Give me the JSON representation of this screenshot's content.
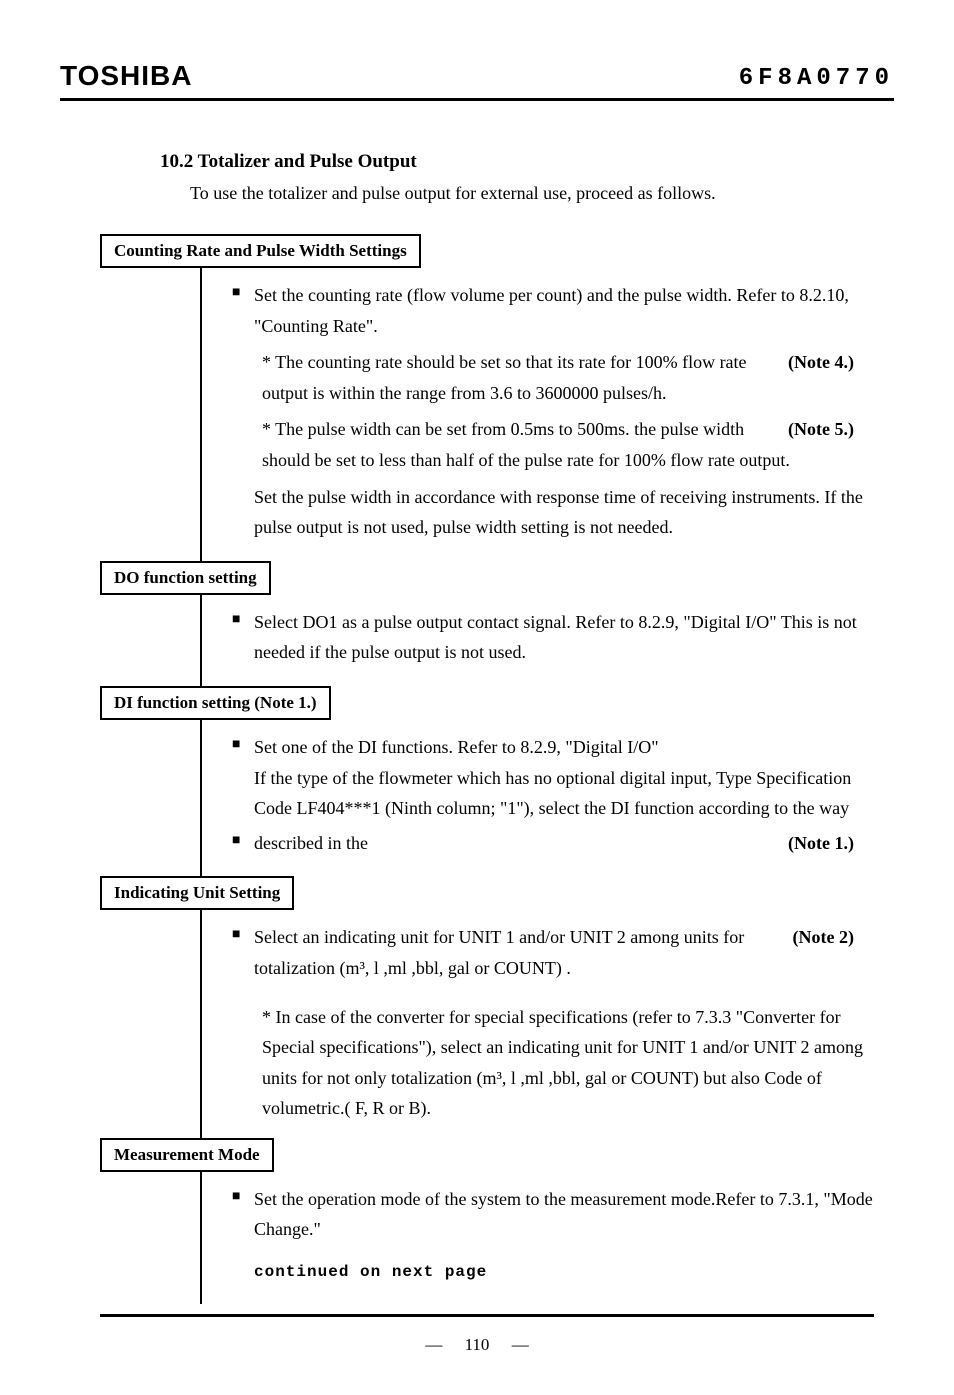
{
  "header": {
    "brand": "TOSHIBA",
    "docnum": "6F8A0770"
  },
  "section": {
    "number_title": "10.2 Totalizer and Pulse Output",
    "intro": "To use the totalizer and pulse output for external use, proceed as follows."
  },
  "boxes": {
    "b1": "Counting Rate and Pulse Width Settings",
    "b2": "DO function setting",
    "b3": "DI function setting   (Note 1.)",
    "b4": "Indicating Unit Setting",
    "b5": "Measurement Mode"
  },
  "content": {
    "b1_p1": "Set the counting rate (flow volume per count) and the pulse width. Refer to 8.2.10, \"Counting Rate\".",
    "b1_s1a": "* The counting rate should be set so that its rate for 100% flow rate output is within the range from 3.6 to 3600000 pulses/h.",
    "b1_s1a_note": "(Note 4.)",
    "b1_s1b": "* The pulse width can be set from 0.5ms to 500ms. the pulse width should be set to less than half of the pulse rate for 100% flow rate output.",
    "b1_s1b_note": "(Note 5.)",
    "b1_p2": "Set the pulse width in accordance with response time of receiving instruments. If the pulse output is not used, pulse width setting is not needed.",
    "b2_p1": "Select DO1 as a pulse output contact signal. Refer to 8.2.9, \"Digital I/O\" This is not needed if the pulse output is not used.",
    "b3_p1": "Set one of the DI functions. Refer to 8.2.9, \"Digital I/O\"",
    "b3_p2": "If the type of the flowmeter which has no optional digital input, Type Specification Code LF404***1 (Ninth column; \"1\"), select the DI function according to the way",
    "b3_p3": "described in the",
    "b3_p3_note": "(Note 1.)",
    "b4_p1": "Select an indicating unit for UNIT 1 and/or UNIT 2 among units for totalization (m³, l ,ml ,bbl, gal or COUNT) .",
    "b4_p1_note": "(Note 2)",
    "b4_s1": "* In case of the converter for special specifications (refer to 7.3.3 \"Converter for Special specifications\"), select an indicating unit for UNIT 1 and/or UNIT 2 among units for not only totalization (m³, l ,ml ,bbl, gal or COUNT) but also Code of volumetric.( F, R or B).",
    "b5_p1": "Set the operation mode of the system to the measurement mode.Refer to 7.3.1, \"Mode Change.\"",
    "continued": "continued on next page"
  },
  "pagenum": "110"
}
